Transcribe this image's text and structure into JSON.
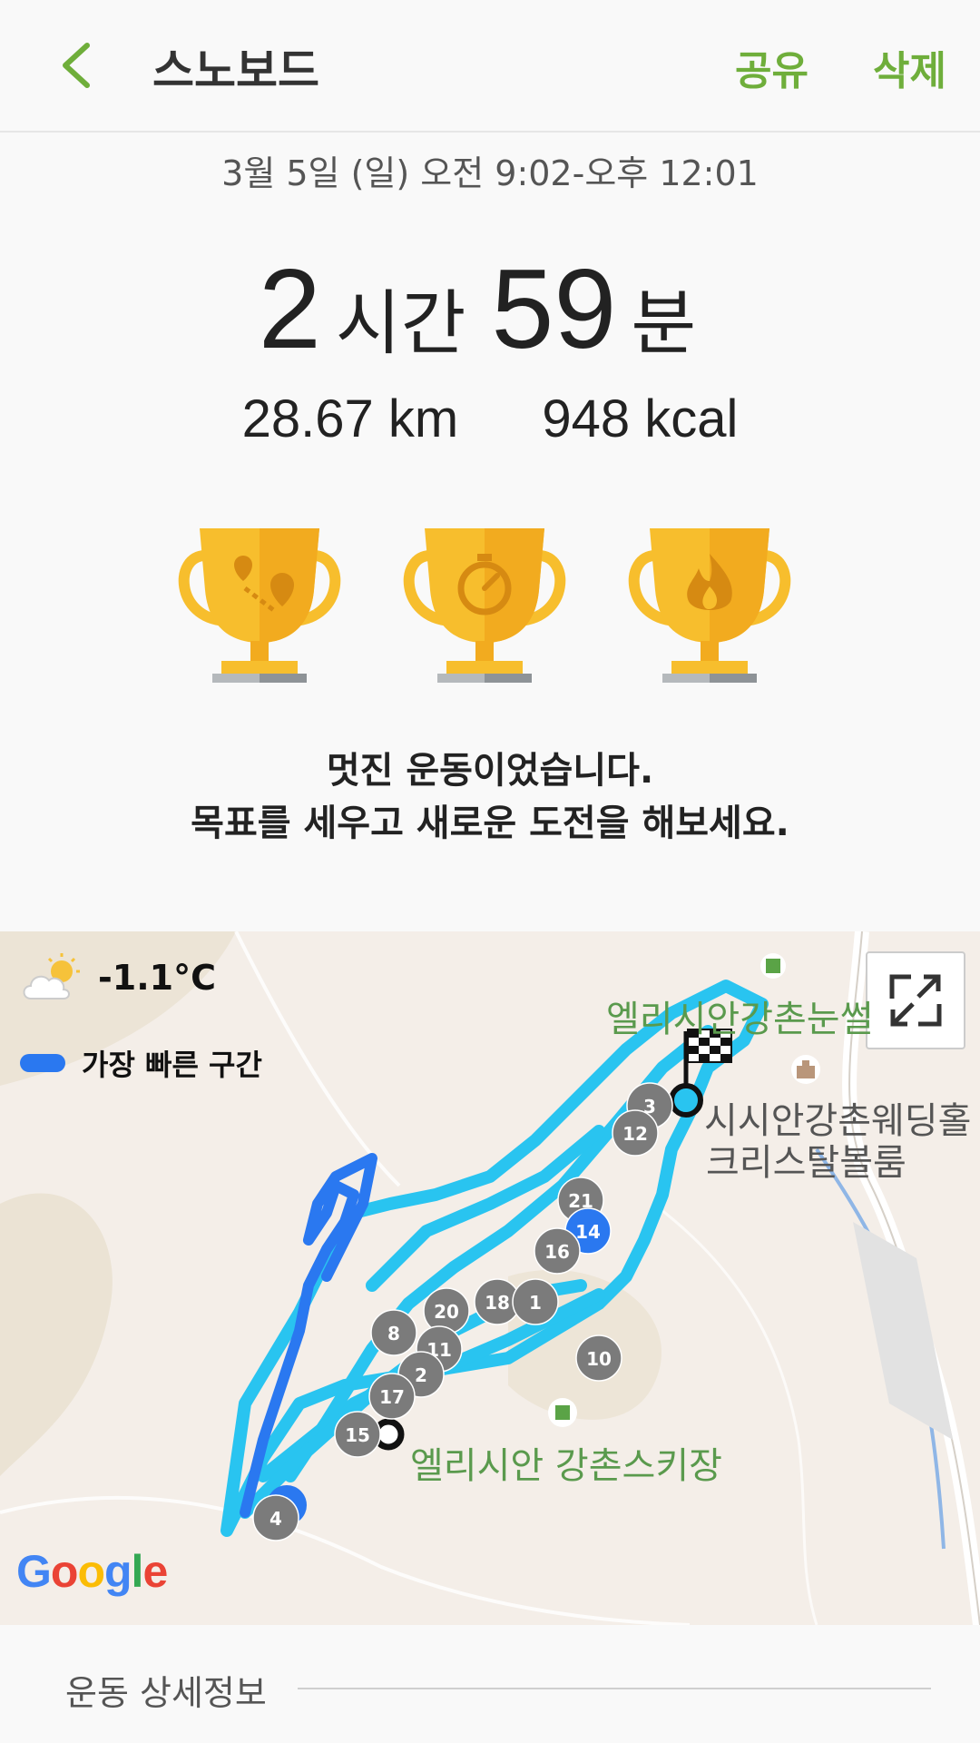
{
  "header": {
    "title": "스노보드",
    "share_label": "공유",
    "delete_label": "삭제"
  },
  "summary": {
    "datetime": "3월 5일 (일) 오전 9:02-오후 12:01",
    "duration_hours": "2",
    "hours_unit": "시간",
    "duration_minutes": "59",
    "minutes_unit": "분",
    "distance": "28.67 km",
    "calories": "948 kcal"
  },
  "trophies": [
    {
      "icon": "distance-trophy-icon"
    },
    {
      "icon": "duration-trophy-icon"
    },
    {
      "icon": "calories-trophy-icon"
    }
  ],
  "message": {
    "line1": "멋진 운동이었습니다.",
    "line2": "목표를 세우고 새로운 도전을 해보세요."
  },
  "map": {
    "temperature": "-1.1°C",
    "legend_label": "가장 빠른 구간",
    "place_1": "엘리시안강촌눈썰",
    "place_2": "시시안강촌웨딩홀",
    "place_3": "크리스탈볼룸",
    "place_4": "엘리시안 강촌스키장",
    "google_logo": "Google",
    "route_color": "#29c4f0",
    "fast_segment_color": "#2a78f0",
    "markers": [
      "3",
      "12",
      "21",
      "14",
      "16",
      "18",
      "1",
      "20",
      "8",
      "11",
      "2",
      "17",
      "10",
      "15",
      "4"
    ]
  },
  "details": {
    "section_title": "운동 상세정보"
  },
  "colors": {
    "accent": "#6fae3b",
    "trophy_gold": "#f7be2d"
  }
}
